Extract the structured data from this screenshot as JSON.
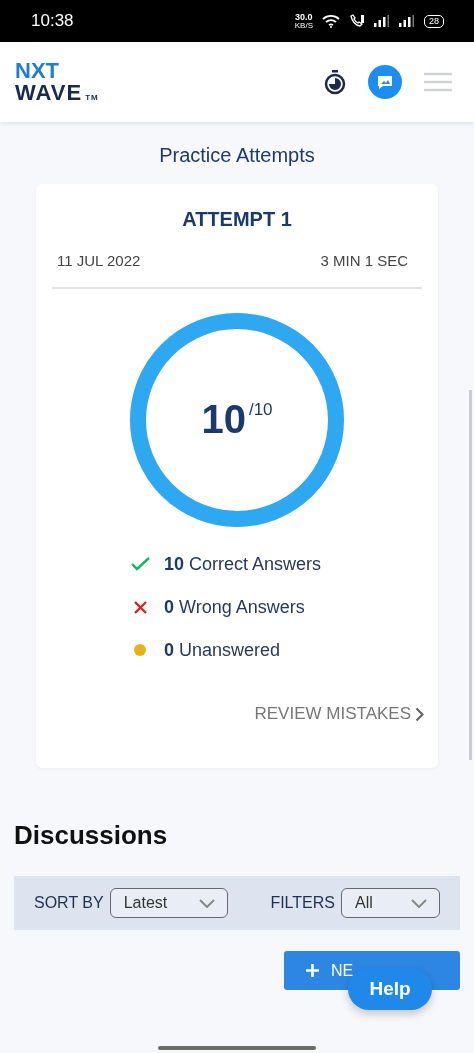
{
  "status_bar": {
    "time": "10:38",
    "speed": "30.0",
    "speed_unit": "KB/S",
    "battery": "28"
  },
  "header": {
    "logo": {
      "line_1": "NXT",
      "line_2": "WAVE",
      "mark": "TM"
    }
  },
  "page_title": "Practice Attempts",
  "attempt": {
    "title": "ATTEMPT 1",
    "date": "11 JUL 2022",
    "duration": "3 MIN 1 SEC",
    "score": "10",
    "total": "/10",
    "level": 1,
    "results": [
      {
        "kind": "correct",
        "count": "10",
        "label": "Correct Answers"
      },
      {
        "kind": "wrong",
        "count": "0",
        "label": "Wrong Answers"
      },
      {
        "kind": "unanswered",
        "count": "0",
        "label": "Unanswered"
      }
    ],
    "review_link": "REVIEW MISTAKES"
  },
  "discussions": {
    "title": "Discussions",
    "sort": {
      "label": "SORT BY",
      "value": "Latest"
    },
    "filter": {
      "label": "FILTERS",
      "value": "All"
    },
    "new_button": "NE"
  },
  "help_button": "Help"
}
